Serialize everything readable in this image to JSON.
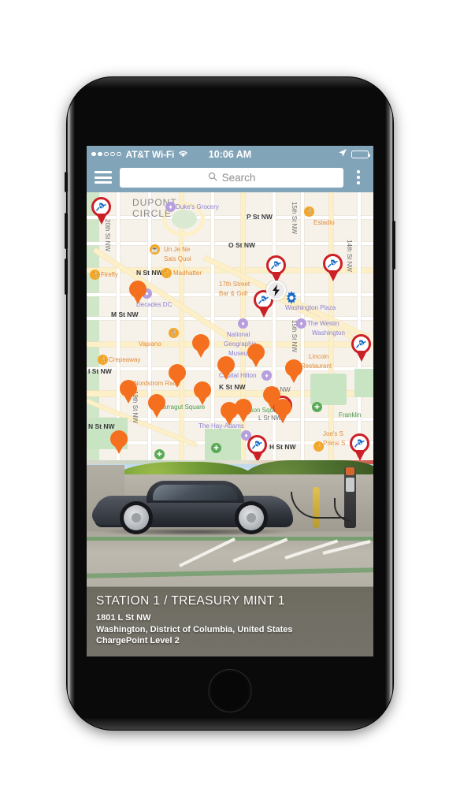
{
  "status_bar": {
    "carrier": "AT&T Wi-Fi",
    "time": "10:06 AM",
    "signal_dots_filled": 2,
    "signal_dots_total": 5,
    "wifi_icon": "wifi-icon",
    "location_icon": "location-arrow-icon",
    "battery_icon": "battery-full-icon",
    "bar_color": "#82a4b9"
  },
  "toolbar": {
    "menu_icon": "hamburger-menu-icon",
    "search_placeholder": "Search",
    "search_value": "",
    "search_icon": "search-icon",
    "overflow_icon": "overflow-menu-icon",
    "bar_color": "#82a4b9"
  },
  "map": {
    "street_labels": [
      "20th St NW",
      "N St NW",
      "M St NW",
      "P St NW",
      "O St NW",
      "15th St NW",
      "14th St NW",
      "K St NW",
      "19th St NW",
      "I St NW",
      "H St NW",
      "L St NW"
    ],
    "place_labels": [
      "DUPONT",
      "CIRCLE",
      "Duke's Grocery",
      "Un Je Ne",
      "Sais Quoi",
      "Madhatter",
      "Firefly",
      "Decades DC",
      "17th Street",
      "Bar & Grill",
      "Estadio",
      "Washington Plaza",
      "The Westin",
      "Washington",
      "Vapiano",
      "Crepeaway",
      "Nordstrom Rack",
      "Farragut Square",
      "National",
      "Geographic",
      "Museum",
      "Capital Hilton",
      "Lincoln",
      "Restaurant",
      "McPherson Square",
      "The Hay-Adams",
      "Joe's S",
      "Prime S",
      "Franklin"
    ],
    "orange_pin_count": 15,
    "red_pin_count": 7,
    "bolt_badge_icon": "lightning-bolt-icon",
    "gear_badge_icon": "gear-icon",
    "orange_pin_color": "#f4701f",
    "red_pin_color": "#cc2027",
    "plug_icon": "ev-plug-icon"
  },
  "photo": {
    "alt_name": "tesla-at-charging-station-photo"
  },
  "info": {
    "title": "STATION 1 / TREASURY MINT 1",
    "address": "1801 L St NW",
    "region": "Washington, District of Columbia, United States",
    "network": "ChargePoint Level 2",
    "panel_color": "#6e6b60"
  },
  "device": {
    "home_button": "home-button",
    "camera": "front-camera",
    "earpiece": "earpiece-speaker"
  }
}
